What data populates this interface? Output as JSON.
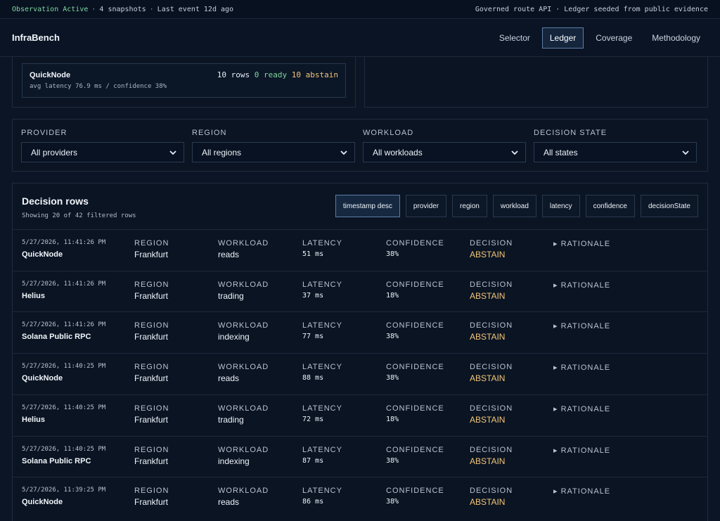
{
  "status": {
    "active": "Observation Active",
    "snapshots": "4 snapshots",
    "last_event": "Last event 12d ago",
    "right": "Governed route API · Ledger seeded from public evidence"
  },
  "header": {
    "brand": "InfraBench",
    "tabs": [
      "Selector",
      "Ledger",
      "Coverage",
      "Methodology"
    ],
    "active_tab": "Ledger"
  },
  "provider_card": {
    "name": "QuickNode",
    "rows": "10 rows",
    "ready": "0 ready",
    "abstain": "10 abstain",
    "sub": "avg latency 76.9 ms / confidence 38%"
  },
  "filters": [
    {
      "label": "PROVIDER",
      "value": "All providers"
    },
    {
      "label": "REGION",
      "value": "All regions"
    },
    {
      "label": "WORKLOAD",
      "value": "All workloads"
    },
    {
      "label": "DECISION STATE",
      "value": "All states"
    }
  ],
  "table": {
    "title": "Decision rows",
    "subtitle": "Showing 20 of 42 filtered rows",
    "sort_buttons": [
      "timestamp desc",
      "provider",
      "region",
      "workload",
      "latency",
      "confidence",
      "decisionState"
    ],
    "col_labels": {
      "region": "REGION",
      "workload": "WORKLOAD",
      "latency": "LATENCY",
      "confidence": "CONFIDENCE",
      "decision": "DECISION",
      "rationale": "▸ RATIONALE"
    },
    "rows": [
      {
        "timestamp": "5/27/2026, 11:41:26 PM",
        "provider": "QuickNode",
        "region": "Frankfurt",
        "workload": "reads",
        "latency": "51 ms",
        "confidence": "38%",
        "decision": "ABSTAIN"
      },
      {
        "timestamp": "5/27/2026, 11:41:26 PM",
        "provider": "Helius",
        "region": "Frankfurt",
        "workload": "trading",
        "latency": "37 ms",
        "confidence": "18%",
        "decision": "ABSTAIN"
      },
      {
        "timestamp": "5/27/2026, 11:41:26 PM",
        "provider": "Solana Public RPC",
        "region": "Frankfurt",
        "workload": "indexing",
        "latency": "77 ms",
        "confidence": "38%",
        "decision": "ABSTAIN"
      },
      {
        "timestamp": "5/27/2026, 11:40:25 PM",
        "provider": "QuickNode",
        "region": "Frankfurt",
        "workload": "reads",
        "latency": "88 ms",
        "confidence": "38%",
        "decision": "ABSTAIN"
      },
      {
        "timestamp": "5/27/2026, 11:40:25 PM",
        "provider": "Helius",
        "region": "Frankfurt",
        "workload": "trading",
        "latency": "72 ms",
        "confidence": "18%",
        "decision": "ABSTAIN"
      },
      {
        "timestamp": "5/27/2026, 11:40:25 PM",
        "provider": "Solana Public RPC",
        "region": "Frankfurt",
        "workload": "indexing",
        "latency": "87 ms",
        "confidence": "38%",
        "decision": "ABSTAIN"
      },
      {
        "timestamp": "5/27/2026, 11:39:25 PM",
        "provider": "QuickNode",
        "region": "Frankfurt",
        "workload": "reads",
        "latency": "86 ms",
        "confidence": "38%",
        "decision": "ABSTAIN"
      }
    ]
  },
  "colors": {
    "background": "#0b1525",
    "ready": "#7fd6a0",
    "abstain": "#f3c576",
    "active_border": "#5d7ea6"
  }
}
